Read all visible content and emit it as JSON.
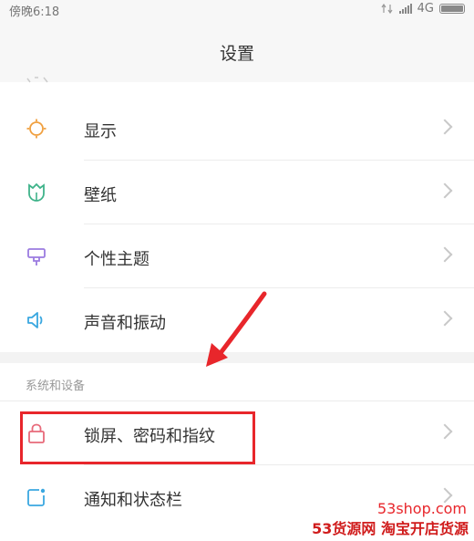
{
  "status_bar": {
    "time": "傍晚6:18",
    "network": "4G"
  },
  "header": {
    "title": "设置"
  },
  "settings_items": [
    {
      "label": "显示",
      "icon": "sun-icon",
      "color": "#f0a040"
    },
    {
      "label": "壁纸",
      "icon": "tulip-icon",
      "color": "#3fb38a"
    },
    {
      "label": "个性主题",
      "icon": "paint-brush-icon",
      "color": "#9b7be0"
    },
    {
      "label": "声音和振动",
      "icon": "speaker-icon",
      "color": "#3aa7e0"
    }
  ],
  "section": {
    "title": "系统和设备"
  },
  "system_items": [
    {
      "label": "锁屏、密码和指纹",
      "icon": "lock-icon",
      "color": "#e86a7a"
    },
    {
      "label": "通知和状态栏",
      "icon": "notification-icon",
      "color": "#3aa7e0"
    }
  ],
  "annotation": {
    "highlight_color": "#e8262b"
  },
  "watermark": {
    "site": "53shop.com",
    "brand": "53货源网 淘宝开店货源"
  }
}
